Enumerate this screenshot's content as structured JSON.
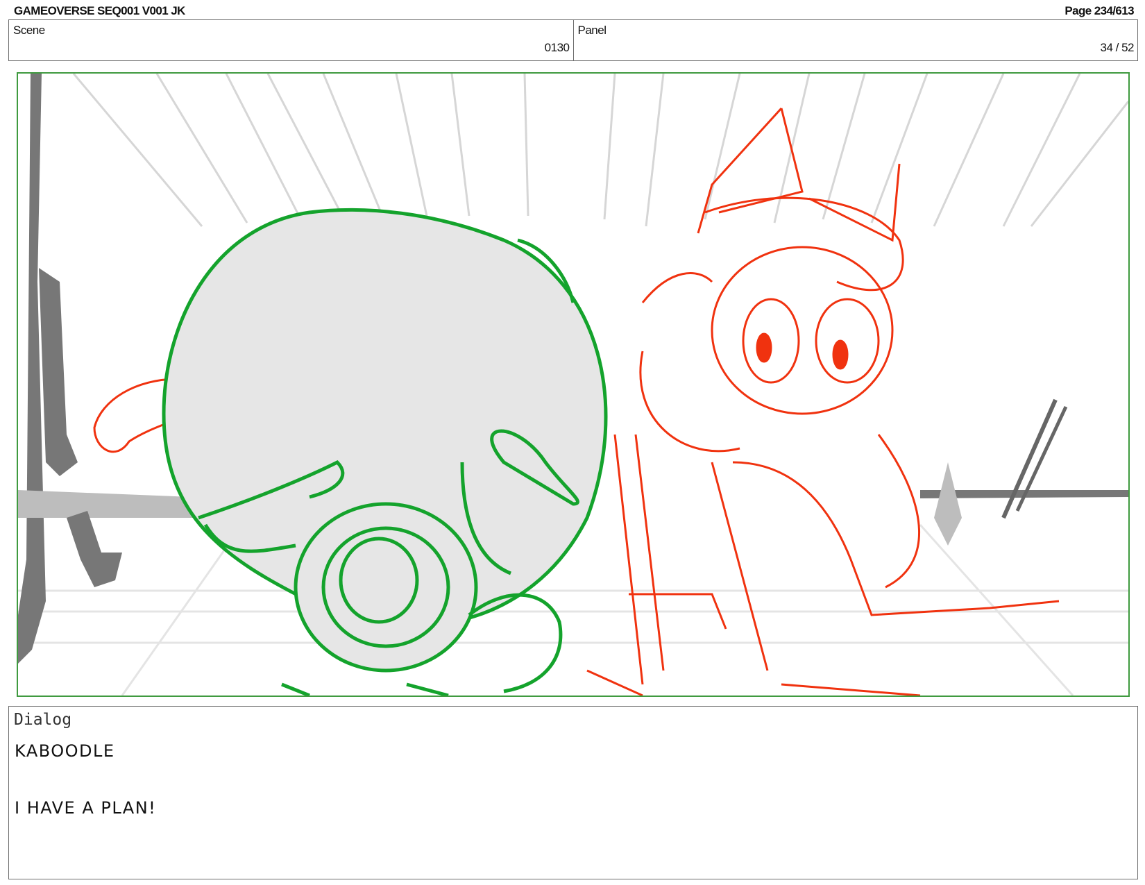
{
  "header": {
    "title": "GAMEOVERSE SEQ001 V001 JK",
    "page": "Page 234/613"
  },
  "info": {
    "scene_label": "Scene",
    "scene_value": "0130",
    "panel_label": "Panel",
    "panel_value": "34 / 52"
  },
  "dialog": {
    "label": "Dialog",
    "lines": [
      "KABOODLE",
      "I HAVE A PLAN!"
    ]
  },
  "colors": {
    "frame_border": "#3f9a3f",
    "green_character": "#14a32c",
    "red_character": "#f0320f",
    "background_sketch": "#777777"
  }
}
